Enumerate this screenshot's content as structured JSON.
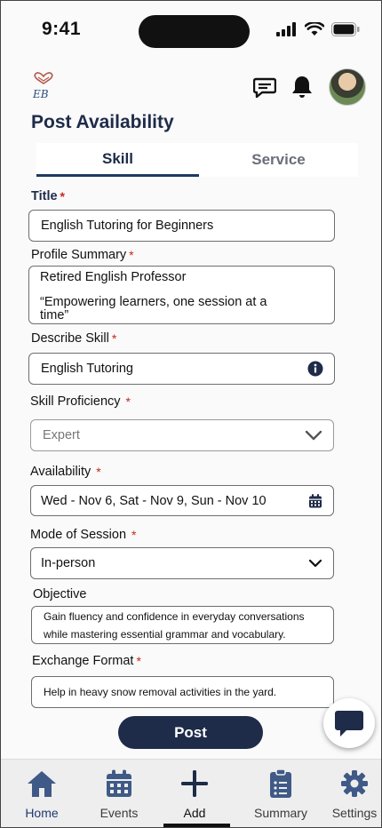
{
  "status": {
    "time": "9:41"
  },
  "page": {
    "title": "Post Availability"
  },
  "tabs": [
    {
      "label": "Skill"
    },
    {
      "label": "Service"
    }
  ],
  "form": {
    "title": {
      "label": "Title",
      "value": "English Tutoring for Beginners"
    },
    "profile_summary": {
      "label": "Profile Summary",
      "line1": "Retired English Professor",
      "line2": "“Empowering learners, one session at a",
      "line3": "time”"
    },
    "describe_skill": {
      "label": "Describe Skill",
      "value": "English Tutoring"
    },
    "skill_proficiency": {
      "label": "Skill Proficiency",
      "value": "Expert"
    },
    "availability": {
      "label": "Availability",
      "value": "Wed - Nov 6, Sat - Nov 9, Sun - Nov 10"
    },
    "mode_of_session": {
      "label": "Mode of Session",
      "value": "In-person"
    },
    "objective": {
      "label": "Objective",
      "line1": "Gain fluency and confidence in everyday conversations",
      "line2": "while mastering essential grammar and vocabulary."
    },
    "exchange_format": {
      "label": "Exchange Format",
      "value": "Help in heavy snow removal activities in the yard."
    }
  },
  "required_marker": "*",
  "post_button": {
    "label": "Post"
  },
  "nav": [
    {
      "label": "Home",
      "icon": "home-icon"
    },
    {
      "label": "Events",
      "icon": "calendar-icon"
    },
    {
      "label": "Add",
      "icon": "plus-icon"
    },
    {
      "label": "Summary",
      "icon": "clipboard-icon"
    },
    {
      "label": "Settings",
      "icon": "gear-icon"
    }
  ],
  "colors": {
    "navy": "#1e2b49",
    "required": "#c8271b",
    "nav_active": "#1e3a6f"
  }
}
